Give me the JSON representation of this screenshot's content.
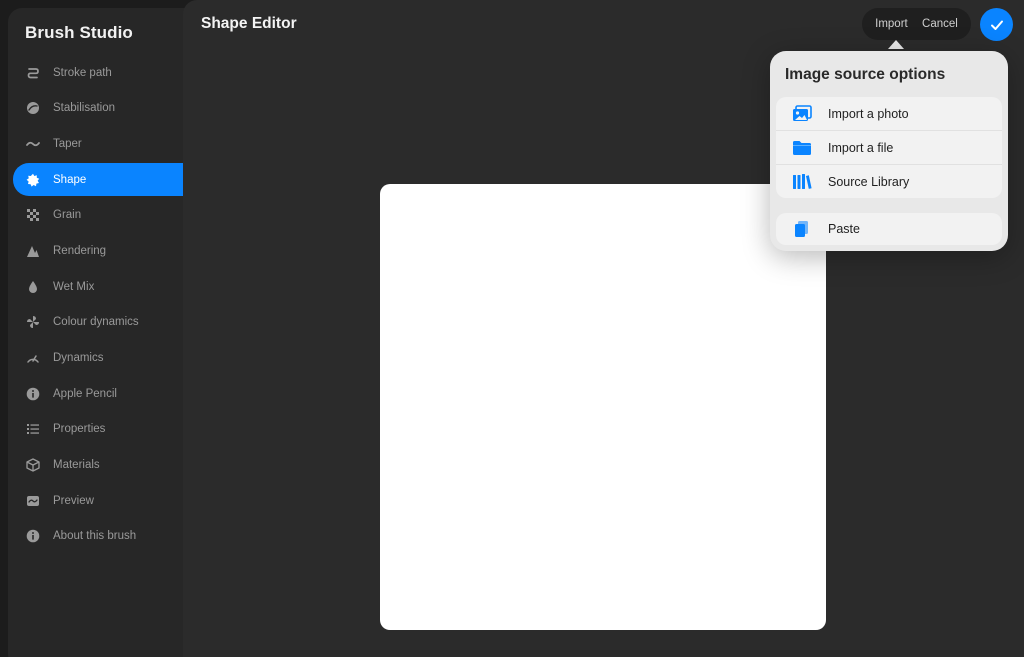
{
  "sidebar": {
    "title": "Brush Studio",
    "items": [
      {
        "label": "Stroke path",
        "icon": "stroke-path-icon"
      },
      {
        "label": "Stabilisation",
        "icon": "stabilisation-icon"
      },
      {
        "label": "Taper",
        "icon": "taper-icon"
      },
      {
        "label": "Shape",
        "icon": "shape-icon",
        "active": true
      },
      {
        "label": "Grain",
        "icon": "grain-icon"
      },
      {
        "label": "Rendering",
        "icon": "rendering-icon"
      },
      {
        "label": "Wet Mix",
        "icon": "wet-mix-icon"
      },
      {
        "label": "Colour dynamics",
        "icon": "colour-dynamics-icon"
      },
      {
        "label": "Dynamics",
        "icon": "dynamics-icon"
      },
      {
        "label": "Apple Pencil",
        "icon": "apple-pencil-icon"
      },
      {
        "label": "Properties",
        "icon": "properties-icon"
      },
      {
        "label": "Materials",
        "icon": "materials-icon"
      },
      {
        "label": "Preview",
        "icon": "preview-icon"
      },
      {
        "label": "About this brush",
        "icon": "about-icon"
      }
    ]
  },
  "header": {
    "title": "Shape Editor",
    "import_label": "Import",
    "cancel_label": "Cancel"
  },
  "popover": {
    "title": "Image source options",
    "options": [
      {
        "label": "Import a photo",
        "icon": "photo-icon"
      },
      {
        "label": "Import a file",
        "icon": "folder-icon"
      },
      {
        "label": "Source Library",
        "icon": "library-icon"
      }
    ],
    "paste_label": "Paste"
  },
  "colors": {
    "accent": "#0a84ff",
    "sidebar_bg": "#272727",
    "main_bg": "#2b2b2b",
    "popover_bg": "#e8e8e8"
  }
}
